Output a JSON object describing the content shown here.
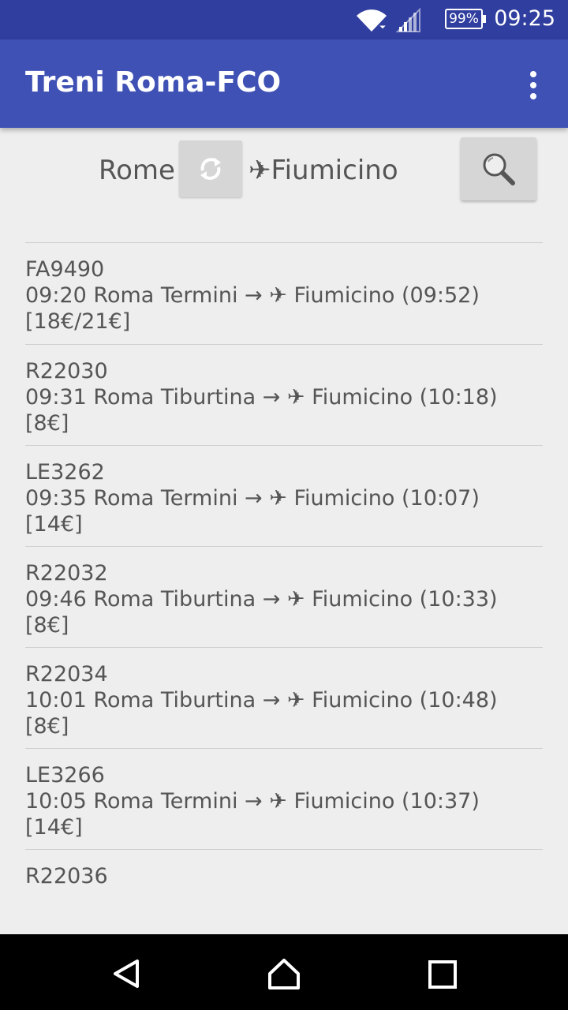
{
  "status_bar": {
    "battery": "99%",
    "time": "09:25",
    "icons": [
      "wifi-icon",
      "signal-icon",
      "battery-icon"
    ]
  },
  "app_bar": {
    "title": "Treni Roma-FCO",
    "menu_icon": "overflow-menu-icon"
  },
  "route": {
    "from": "Rome",
    "to": "✈Fiumicino",
    "swap_icon": "swap-refresh-icon",
    "search_icon": "search-icon"
  },
  "trains": [
    {
      "code": "FA9490",
      "desc": "09:20 Roma Termini → ✈ Fiumicino (09:52)  [18€/21€]"
    },
    {
      "code": "R22030",
      "desc": "09:31 Roma Tiburtina → ✈ Fiumicino (10:18)  [8€]"
    },
    {
      "code": "LE3262",
      "desc": "09:35 Roma Termini → ✈ Fiumicino (10:07)  [14€]"
    },
    {
      "code": "R22032",
      "desc": "09:46 Roma Tiburtina → ✈ Fiumicino (10:33)  [8€]"
    },
    {
      "code": "R22034",
      "desc": "10:01 Roma Tiburtina → ✈ Fiumicino (10:48)  [8€]"
    },
    {
      "code": "LE3266",
      "desc": "10:05 Roma Termini → ✈ Fiumicino (10:37)  [14€]"
    },
    {
      "code": "R22036",
      "desc": ""
    }
  ],
  "nav_bar": {
    "icons": [
      "back-icon",
      "home-icon",
      "recents-icon"
    ]
  },
  "colors": {
    "status_bar": "#303f9f",
    "app_bar": "#3f51b5",
    "background": "#eeeeee"
  }
}
